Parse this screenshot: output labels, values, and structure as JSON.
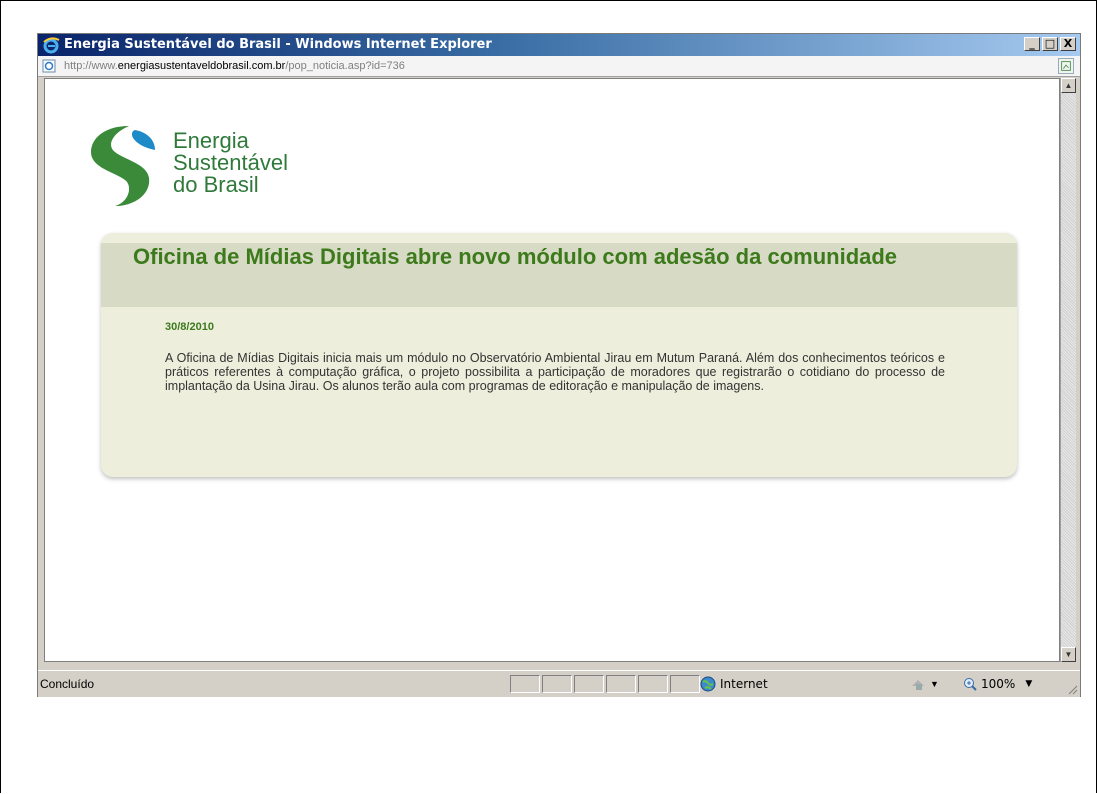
{
  "window": {
    "title": "Energia Sustentável do Brasil - Windows Internet Explorer",
    "minimize_glyph": "_",
    "maximize_glyph": "□",
    "close_glyph": "X"
  },
  "address": {
    "prefix": "http://www.",
    "host": "energiasustentaveldobrasil.com.br",
    "path": "/pop_noticia.asp?id=736"
  },
  "logo": {
    "line1": "Energia",
    "line2": "Sustentável",
    "line3": "do Brasil",
    "colors": {
      "green": "#3a8a3a",
      "blue": "#1e8ac8"
    }
  },
  "article": {
    "headline": "Oficina de Mídias Digitais abre novo módulo com adesão da comunidade",
    "date": "30/8/2010",
    "body": "A Oficina de Mídias Digitais inicia mais um módulo no Observatório Ambiental Jirau em Mutum Paraná. Além dos conhecimentos teóricos e práticos referentes à computação gráfica, o projeto possibilita a participação de moradores que registrarão o cotidiano do processo de implantação da Usina Jirau. Os alunos terão aula com programas de editoração e manipulação de imagens."
  },
  "status": {
    "text": "Concluído",
    "zone": "Internet",
    "zoom": "100%"
  },
  "icons": [
    "ie-logo-icon",
    "page-icon",
    "rss-feed-icon",
    "globe-icon",
    "protected-mode-icon",
    "zoom-icon",
    "resize-grip-icon"
  ],
  "colors": {
    "accent": "#3c7a1c",
    "card_bg": "#eeeedd",
    "card_head": "#d7dac4"
  }
}
